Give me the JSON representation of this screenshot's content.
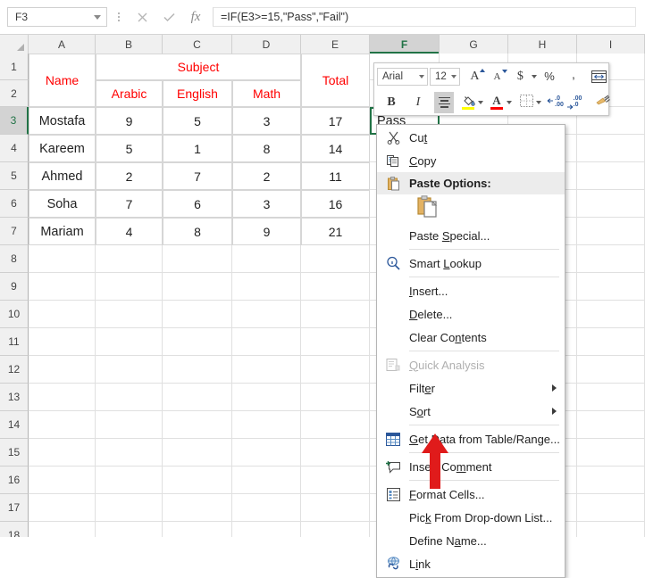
{
  "formula_bar": {
    "name_box_value": "F3",
    "name_box_icon": "chevron-down-icon",
    "cancel_icon": "close-icon",
    "enter_icon": "check-icon",
    "fx_label": "fx",
    "formula": "=IF(E3>=15,\"Pass\",\"Fail\")"
  },
  "grid": {
    "column_headers": [
      "A",
      "B",
      "C",
      "D",
      "E",
      "F",
      "G",
      "H",
      "I"
    ],
    "selected_column": "F",
    "row_headers": [
      "1",
      "2",
      "3",
      "4",
      "5",
      "6",
      "7",
      "8",
      "9",
      "10",
      "11",
      "12",
      "13",
      "14",
      "15",
      "16",
      "17",
      "18"
    ],
    "selected_row": "3",
    "header_color": "#ff0000",
    "selection_color": "#217346",
    "table": {
      "name_header": "Name",
      "subject_header": "Subject",
      "subject_columns": [
        "Arabic",
        "English",
        "Math"
      ],
      "total_header": "Total",
      "rows": [
        {
          "name": "Mostafa",
          "arabic": "9",
          "english": "5",
          "math": "3",
          "total": "17"
        },
        {
          "name": "Kareem",
          "arabic": "5",
          "english": "1",
          "math": "8",
          "total": "14"
        },
        {
          "name": "Ahmed",
          "arabic": "2",
          "english": "7",
          "math": "2",
          "total": "11"
        },
        {
          "name": "Soha",
          "arabic": "7",
          "english": "6",
          "math": "3",
          "total": "16"
        },
        {
          "name": "Mariam",
          "arabic": "4",
          "english": "8",
          "math": "9",
          "total": "21"
        }
      ]
    },
    "active_cell": {
      "ref": "F3",
      "value": "Pass"
    }
  },
  "mini_toolbar": {
    "font_name": "Arial",
    "font_size": "12",
    "grow_font": "A",
    "shrink_font": "A",
    "currency": "$",
    "percent": "%",
    "comma": ",",
    "merge_cells_icon": "merge-cells-icon",
    "bold": "B",
    "italic": "I",
    "align_center_icon": "align-center-icon",
    "fill_color_glyph": "fill-color-icon",
    "fill_color": "#ffff00",
    "font_color_glyph": "A",
    "font_color": "#ff0000",
    "borders_icon": "borders-icon",
    "decrease_decimal": ".00",
    "increase_decimal": ".00",
    "format_painter_icon": "format-painter-icon"
  },
  "context_menu": {
    "items": [
      {
        "label": "Cut",
        "icon": "scissors-icon",
        "type": "item",
        "disabled": false,
        "submenu": false
      },
      {
        "label": "Copy",
        "icon": "copy-icon",
        "type": "item",
        "disabled": false,
        "submenu": false
      },
      {
        "label": "Paste Options:",
        "icon": "clipboard-icon",
        "type": "header",
        "disabled": false,
        "submenu": false
      },
      {
        "label": "",
        "icon": "paste-icon",
        "type": "paste-gallery",
        "disabled": false,
        "submenu": false
      },
      {
        "label": "Paste Special...",
        "icon": "",
        "type": "item",
        "disabled": false,
        "submenu": false
      },
      {
        "type": "separator"
      },
      {
        "label": "Smart Lookup",
        "icon": "smart-lookup-icon",
        "type": "item",
        "disabled": false,
        "submenu": false
      },
      {
        "type": "separator"
      },
      {
        "label": "Insert...",
        "icon": "",
        "type": "item",
        "disabled": false,
        "submenu": false
      },
      {
        "label": "Delete...",
        "icon": "",
        "type": "item",
        "disabled": false,
        "submenu": false
      },
      {
        "label": "Clear Contents",
        "icon": "",
        "type": "item",
        "disabled": false,
        "submenu": false
      },
      {
        "type": "separator"
      },
      {
        "label": "Quick Analysis",
        "icon": "quick-analysis-icon",
        "type": "item",
        "disabled": true,
        "submenu": false
      },
      {
        "label": "Filter",
        "icon": "",
        "type": "item",
        "disabled": false,
        "submenu": true
      },
      {
        "label": "Sort",
        "icon": "",
        "type": "item",
        "disabled": false,
        "submenu": true
      },
      {
        "type": "separator"
      },
      {
        "label": "Get Data from Table/Range...",
        "icon": "table-icon",
        "type": "item",
        "disabled": false,
        "submenu": false
      },
      {
        "type": "separator"
      },
      {
        "label": "Insert Comment",
        "icon": "comment-icon",
        "type": "item",
        "disabled": false,
        "submenu": false
      },
      {
        "type": "separator"
      },
      {
        "label": "Format Cells...",
        "icon": "format-cells-icon",
        "type": "item",
        "disabled": false,
        "submenu": false
      },
      {
        "label": "Pick From Drop-down List...",
        "icon": "",
        "type": "item",
        "disabled": false,
        "submenu": false
      },
      {
        "label": "Define Name...",
        "icon": "",
        "type": "item",
        "disabled": false,
        "submenu": false
      },
      {
        "label": "Link",
        "icon": "link-icon",
        "type": "item",
        "disabled": false,
        "submenu": false
      }
    ]
  },
  "annotation": {
    "arrow_color": "#e01b1b",
    "points_at": "Insert Comment"
  }
}
